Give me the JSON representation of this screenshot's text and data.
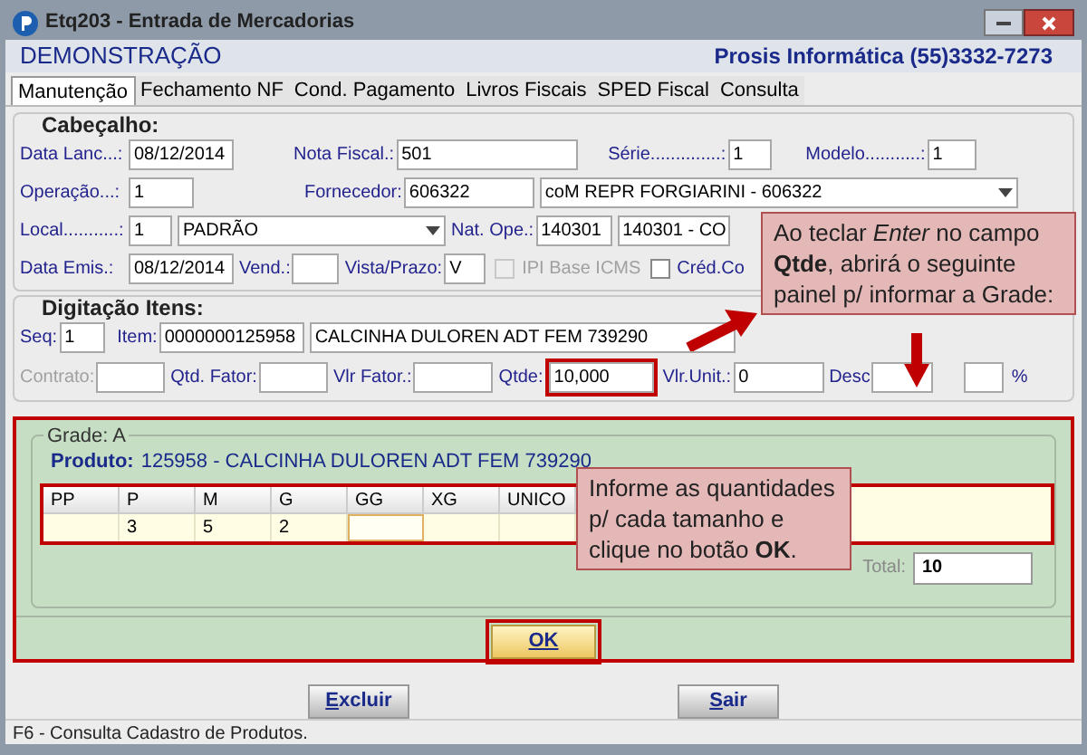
{
  "window": {
    "title": "Etq203 - Entrada de Mercadorias"
  },
  "header": {
    "company": "DEMONSTRAÇÃO",
    "vendor": "Prosis Informática (55)3332-7273"
  },
  "tabs": [
    {
      "label": "Manutenção",
      "selected": true
    },
    {
      "label": "Fechamento NF",
      "selected": false
    },
    {
      "label": "Cond. Pagamento",
      "selected": false
    },
    {
      "label": "Livros Fiscais",
      "selected": false
    },
    {
      "label": "SPED Fiscal",
      "selected": false
    },
    {
      "label": "Consulta",
      "selected": false
    }
  ],
  "cabecalho": {
    "title": "Cabeçalho:",
    "lines": [
      {
        "fields": [
          {
            "kind": "text",
            "label": "Data Lanc...:",
            "value": "08/12/2014"
          },
          {
            "kind": "text",
            "label": "Nota Fiscal.:",
            "value": "501"
          },
          {
            "kind": "text",
            "label": "Série..............:",
            "value": "1"
          },
          {
            "kind": "text",
            "label": "Modelo...........:",
            "value": "1"
          }
        ]
      },
      {
        "fields": [
          {
            "kind": "text",
            "label": "Operação...:",
            "value": "1"
          },
          {
            "kind": "text",
            "label": "Fornecedor:",
            "value": "606322"
          },
          {
            "kind": "select",
            "value": "coM REPR FORGIARINI - 606322"
          }
        ]
      },
      {
        "fields": [
          {
            "kind": "text",
            "label": "Local...........:",
            "value": "1"
          },
          {
            "kind": "select",
            "value": "PADRÃO"
          },
          {
            "kind": "text",
            "label": "Nat. Ope.:",
            "value": "140301"
          },
          {
            "kind": "text",
            "value": "140301 - CO"
          }
        ]
      },
      {
        "fields": [
          {
            "kind": "text",
            "label": "Data Emis.:",
            "value": "08/12/2014"
          },
          {
            "kind": "text",
            "label": "Vend.:"
          },
          {
            "kind": "text",
            "label": "Vista/Prazo:",
            "value": "V"
          },
          {
            "kind": "checkbox",
            "label": "IPI Base ICMS",
            "checked": false,
            "disabled": true
          },
          {
            "kind": "checkbox",
            "label": "Créd.Co",
            "checked": false,
            "disabled": false
          }
        ]
      }
    ]
  },
  "itens": {
    "title": "Digitação Itens:",
    "lines": [
      {
        "fields": [
          {
            "kind": "text",
            "label": "Seq:",
            "value": "1"
          },
          {
            "kind": "text",
            "label": "Item:",
            "value": "0000000125958"
          },
          {
            "kind": "text",
            "value": "CALCINHA DULOREN ADT FEM 739290"
          }
        ]
      },
      {
        "fields": [
          {
            "kind": "text",
            "label": "Contrato:",
            "disabled": true
          },
          {
            "kind": "text",
            "label": "Qtd. Fator:"
          },
          {
            "kind": "text",
            "label": "Vlr Fator.:"
          },
          {
            "kind": "text",
            "label": "Qtde:",
            "value": "10,000",
            "highlighted": true
          },
          {
            "kind": "text",
            "label": "Vlr.Unit.:",
            "value": "0"
          },
          {
            "kind": "text",
            "label": "Desc"
          },
          {
            "kind": "text",
            "unit": "%"
          }
        ]
      }
    ]
  },
  "grade": {
    "title": "Grade: A",
    "product_label": "Produto:",
    "product": "125958 - CALCINHA DULOREN ADT FEM 739290",
    "sizes": [
      {
        "size": "PP",
        "focused": false
      },
      {
        "size": "P",
        "qty": "3",
        "focused": false
      },
      {
        "size": "M",
        "qty": "5",
        "focused": false
      },
      {
        "size": "G",
        "qty": "2",
        "focused": false
      },
      {
        "size": "GG",
        "focused": true
      },
      {
        "size": "XG",
        "focused": false
      },
      {
        "size": "UNICO",
        "focused": false
      }
    ],
    "total_label": "Total:",
    "total": "10",
    "ok": "OK"
  },
  "buttons": [
    "Excluir",
    "Sair"
  ],
  "status_bar": "F6 - Consulta Cadastro de Produtos.",
  "callouts": [
    {
      "text": "Ao teclar *Enter* no campo **Qtde**, abrirá o seguinte painel p/ informar a Grade:"
    },
    {
      "text": "Informe as quantidades p/ cada tamanho e clique no botão **OK**."
    }
  ]
}
